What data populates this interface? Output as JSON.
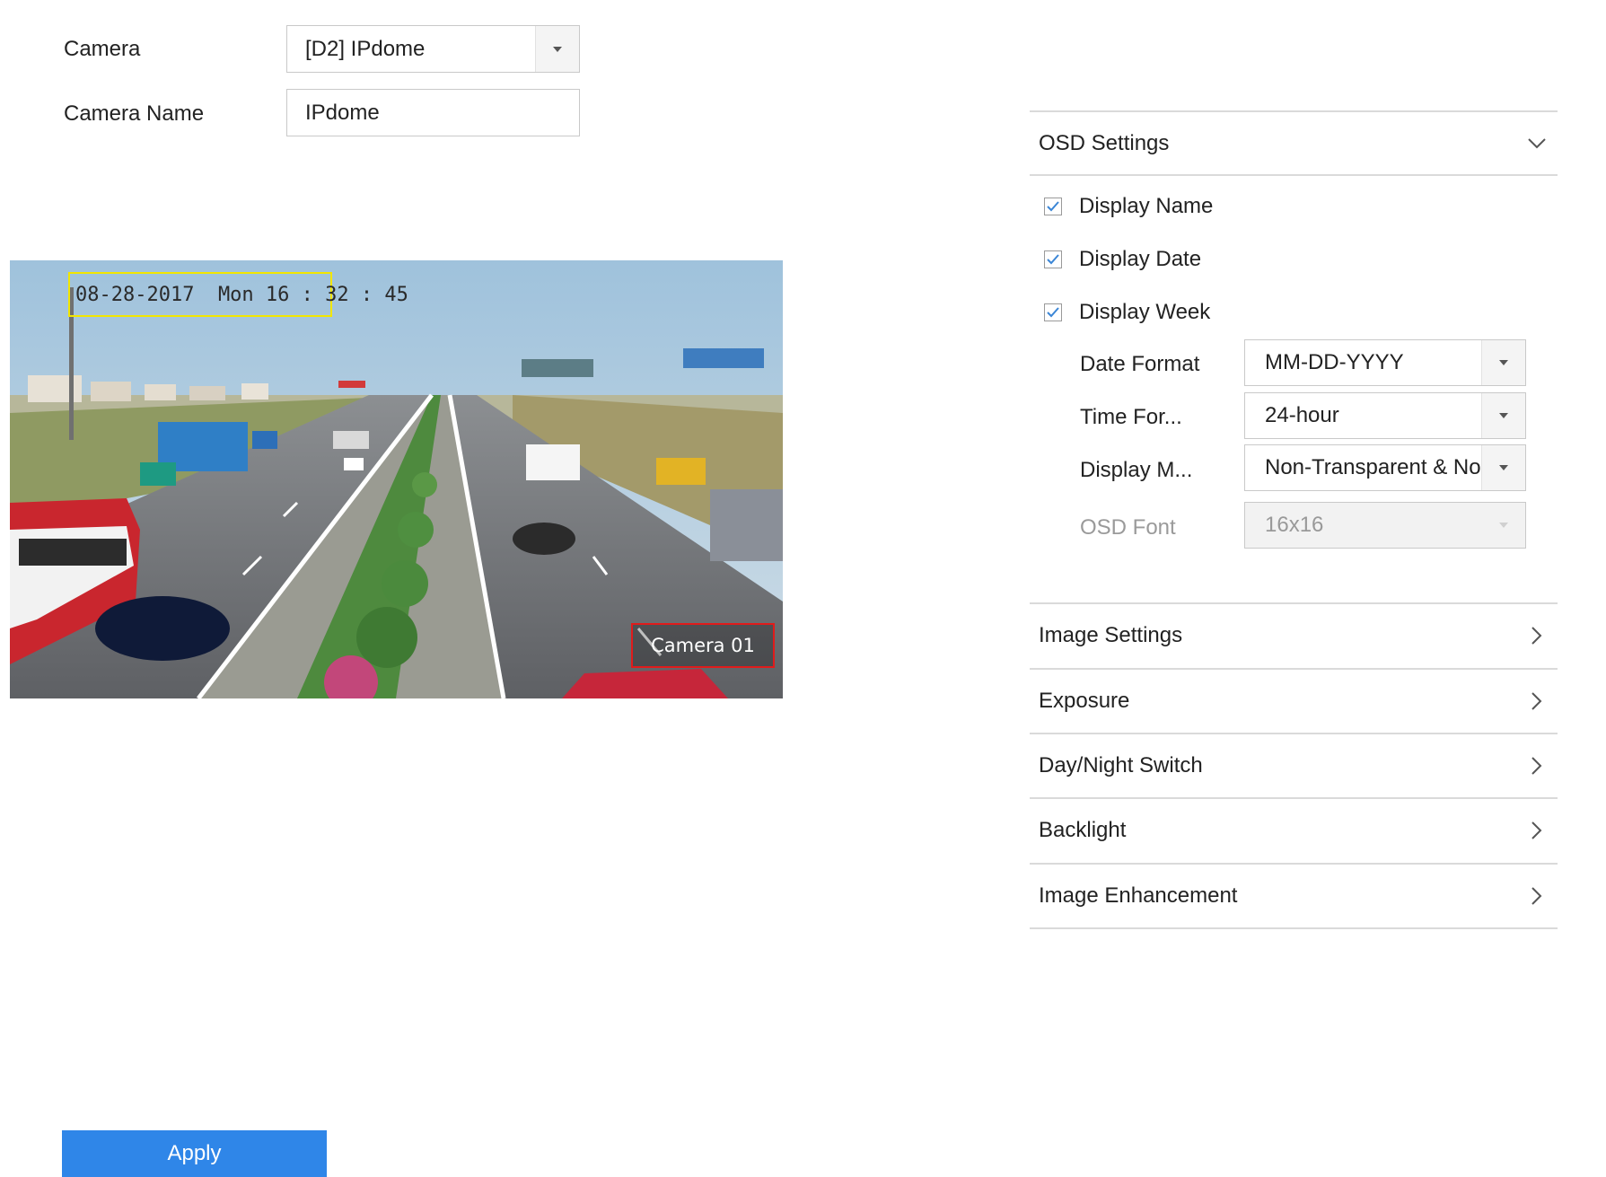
{
  "form": {
    "camera_label": "Camera",
    "camera_value": "[D2] IPdome",
    "camera_name_label": "Camera Name",
    "camera_name_value": "IPdome"
  },
  "preview": {
    "osd_date": "08-28-2017  Mon 16 : 32 : 45",
    "osd_name": "Camera 01",
    "date_box_color": "#f2e600",
    "name_box_color": "#e01b1b"
  },
  "osd_settings": {
    "title": "OSD Settings",
    "expanded": true,
    "checkboxes": [
      {
        "label": "Display Name",
        "checked": true
      },
      {
        "label": "Display Date",
        "checked": true
      },
      {
        "label": "Display Week",
        "checked": true
      }
    ],
    "options": [
      {
        "label": "Date Format",
        "value": "MM-DD-YYYY",
        "disabled": false
      },
      {
        "label": "Time For...",
        "value": "24-hour",
        "disabled": false
      },
      {
        "label": "Display M...",
        "value": "Non-Transparent & No",
        "disabled": false
      },
      {
        "label": "OSD Font",
        "value": "16x16",
        "disabled": true
      }
    ]
  },
  "sections": [
    {
      "title": "Image Settings"
    },
    {
      "title": "Exposure"
    },
    {
      "title": "Day/Night Switch"
    },
    {
      "title": "Backlight"
    },
    {
      "title": "Image Enhancement"
    }
  ],
  "actions": {
    "apply_label": "Apply",
    "accent_color": "#2f86e8"
  }
}
